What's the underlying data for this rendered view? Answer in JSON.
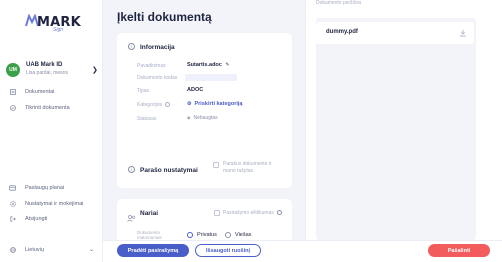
{
  "brand": {
    "name": "MARK",
    "tagline": "Sign"
  },
  "user": {
    "initials": "UM",
    "name": "UAB Mark ID",
    "subtitle": "Lisa pardai, mesos"
  },
  "nav": {
    "main": [
      {
        "label": "Dokumentai",
        "icon": "document-icon"
      },
      {
        "label": "Tikrinti dokumenta",
        "icon": "check-circle-icon"
      }
    ],
    "bottom": [
      {
        "label": "Paslaugų planai",
        "icon": "card-icon"
      },
      {
        "label": "Nustatymai ir mokėjimai",
        "icon": "gear-icon"
      },
      {
        "label": "Atsijungti",
        "icon": "logout-icon"
      },
      {
        "label": "Lietuvių",
        "icon": "globe-icon"
      }
    ]
  },
  "page": {
    "title": "Įkelti dokumentą"
  },
  "info_card": {
    "title": "Informacija",
    "fields": [
      {
        "label": "Pavadinimas",
        "value": "Sutartis.adoc"
      },
      {
        "label": "Dokumento kodas",
        "value": ""
      },
      {
        "label": "Tipas",
        "value": "ADOC"
      },
      {
        "label": "Kategorijos",
        "value": "Priskirti kategoriją"
      },
      {
        "label": "Statusas",
        "value": "Nebaugtas"
      }
    ]
  },
  "signature_card": {
    "title": "Parašo nustatymai",
    "checkbox_label": "Parašus dokumente ir mano rašytas"
  },
  "members_card": {
    "title": "Nariai",
    "order_label": "Pasirašymo eiliškumas",
    "visibility_label": "Dokumento matomumas",
    "options": [
      "Privatus",
      "Viešas"
    ],
    "selected": "Privatus"
  },
  "preview": {
    "label": "Dokumento peržiūra",
    "file_name": "dummy.pdf"
  },
  "footer": {
    "primary": "Pradėti pasirašymą",
    "secondary": "Išsaugoti ruošinį",
    "danger": "Pašalinti"
  },
  "colors": {
    "accent": "#4a5ec9",
    "danger": "#f25c5c",
    "avatar": "#3aa04a"
  }
}
